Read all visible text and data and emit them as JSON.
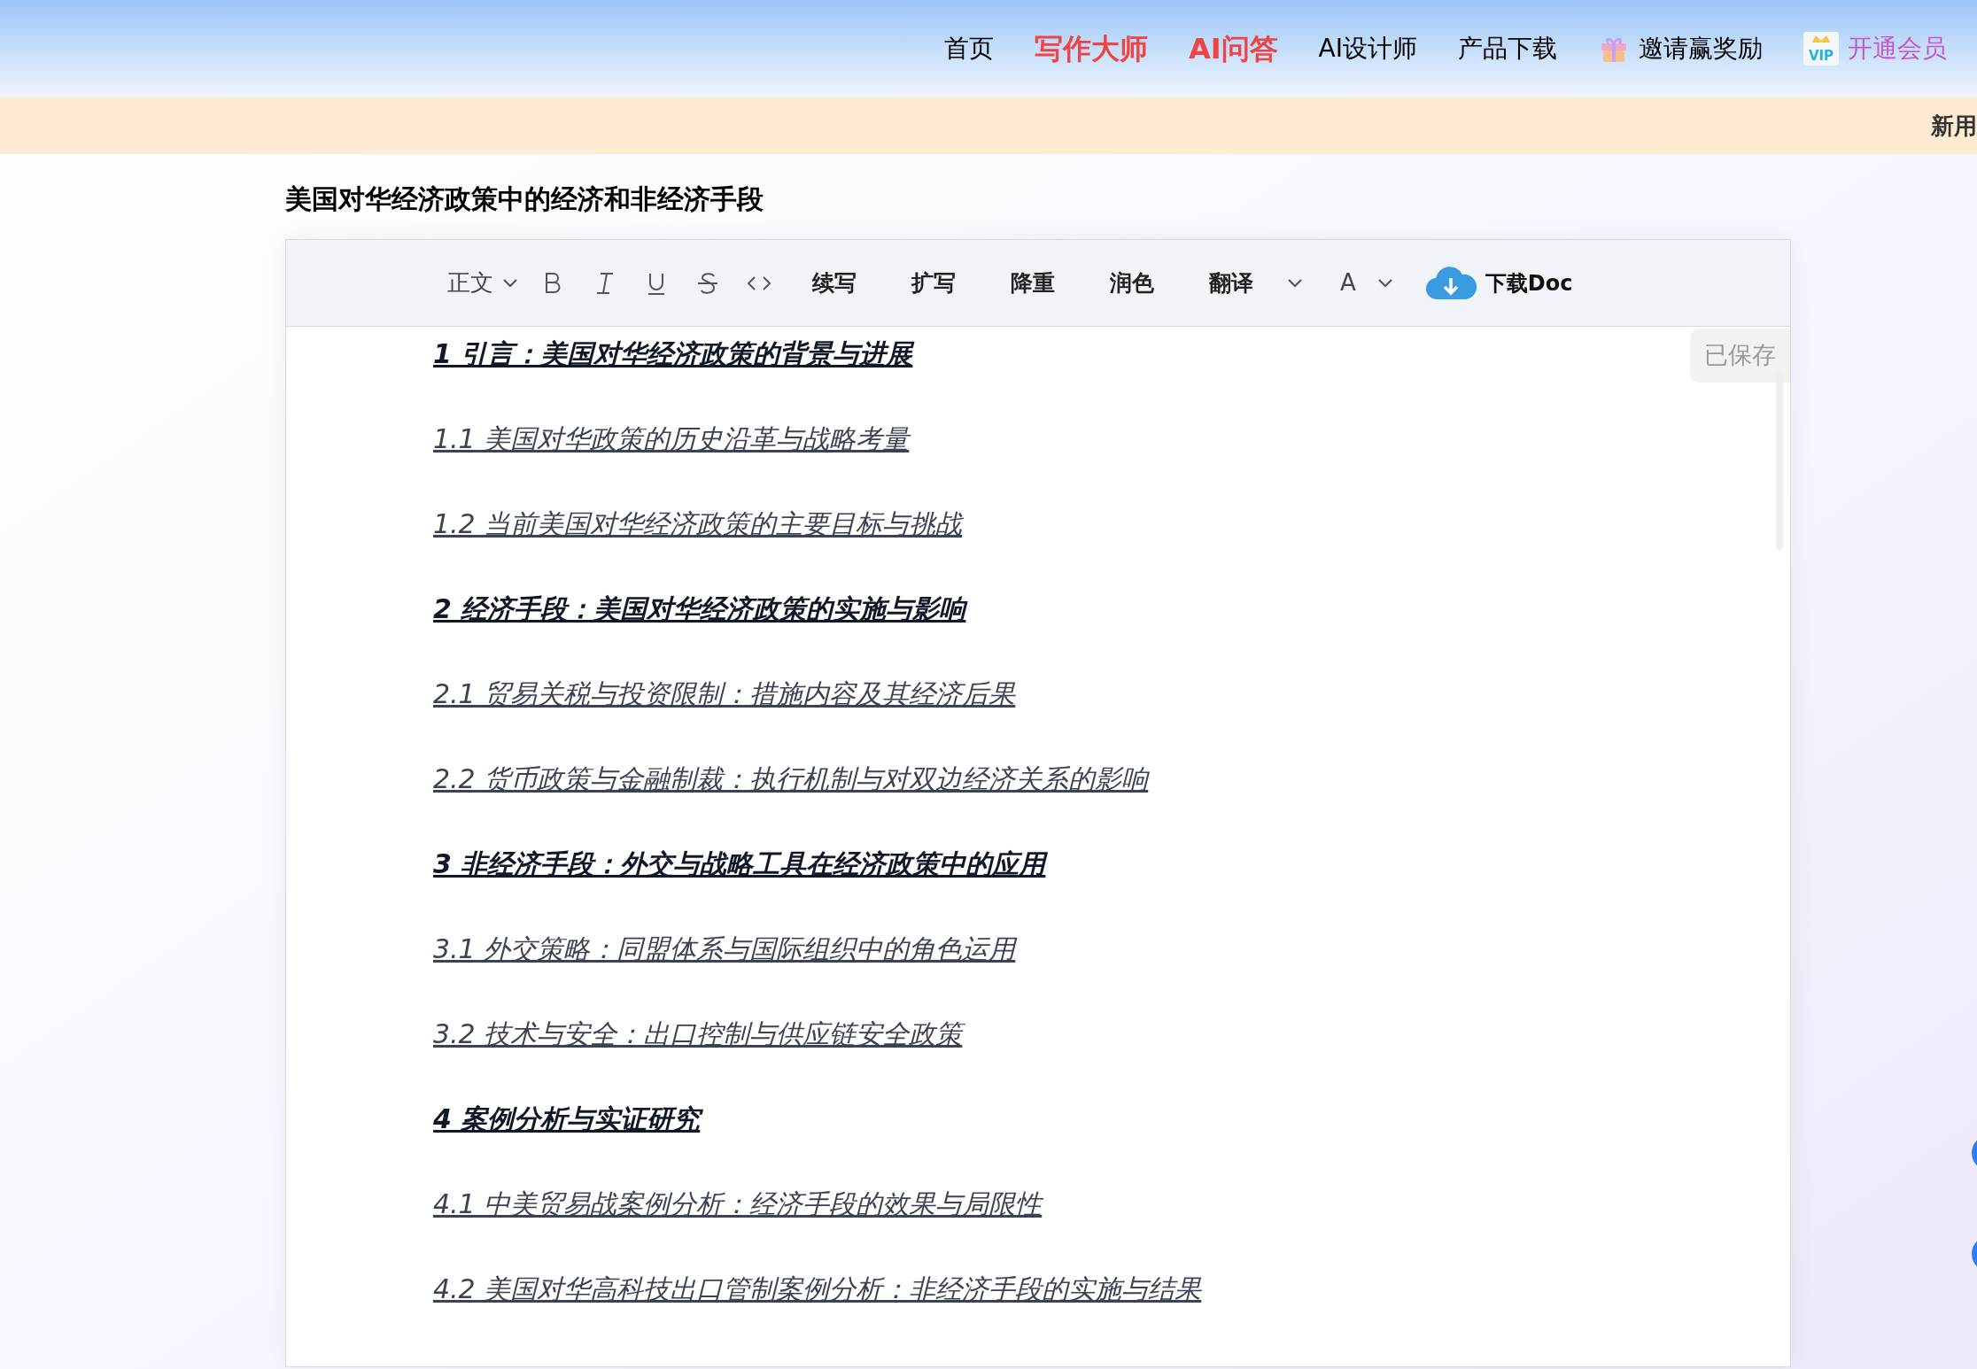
{
  "nav": [
    {
      "label": "首页",
      "kind": "plain"
    },
    {
      "label": "写作大师",
      "kind": "highlight"
    },
    {
      "label": "AI问答",
      "kind": "highlight"
    },
    {
      "label": "AI设计师",
      "kind": "plain"
    },
    {
      "label": "产品下载",
      "kind": "plain"
    },
    {
      "label": "邀请赢奖励",
      "kind": "invite"
    },
    {
      "label": "开通会员",
      "kind": "vip",
      "badge": "VIP"
    }
  ],
  "notice": "新用",
  "document_title": "美国对华经济政策中的经济和非经济手段",
  "toolbar": {
    "style": "正文",
    "actions": [
      "续写",
      "扩写",
      "降重",
      "润色"
    ],
    "translate": "翻译",
    "font": "A",
    "download": "下载Doc"
  },
  "save_status": "已保存",
  "outline": [
    {
      "kind": "heading",
      "text": "1 引言：美国对华经济政策的背景与进展"
    },
    {
      "kind": "subheading",
      "text": "1.1 美国对华政策的历史沿革与战略考量"
    },
    {
      "kind": "subheading",
      "text": "1.2 当前美国对华经济政策的主要目标与挑战"
    },
    {
      "kind": "heading",
      "text": "2 经济手段：美国对华经济政策的实施与影响"
    },
    {
      "kind": "subheading",
      "text": "2.1 贸易关税与投资限制：措施内容及其经济后果"
    },
    {
      "kind": "subheading",
      "text": "2.2 货币政策与金融制裁：执行机制与对双边经济关系的影响"
    },
    {
      "kind": "heading",
      "text": "3 非经济手段：外交与战略工具在经济政策中的应用"
    },
    {
      "kind": "subheading",
      "text": "3.1 外交策略：同盟体系与国际组织中的角色运用"
    },
    {
      "kind": "subheading",
      "text": "3.2 技术与安全：出口控制与供应链安全政策"
    },
    {
      "kind": "heading",
      "text": "4 案例分析与实证研究"
    },
    {
      "kind": "subheading",
      "text": "4.1 中美贸易战案例分析：经济手段的效果与局限性"
    },
    {
      "kind": "subheading",
      "text": "4.2 美国对华高科技出口管制案例分析：非经济手段的实施与结果"
    }
  ]
}
